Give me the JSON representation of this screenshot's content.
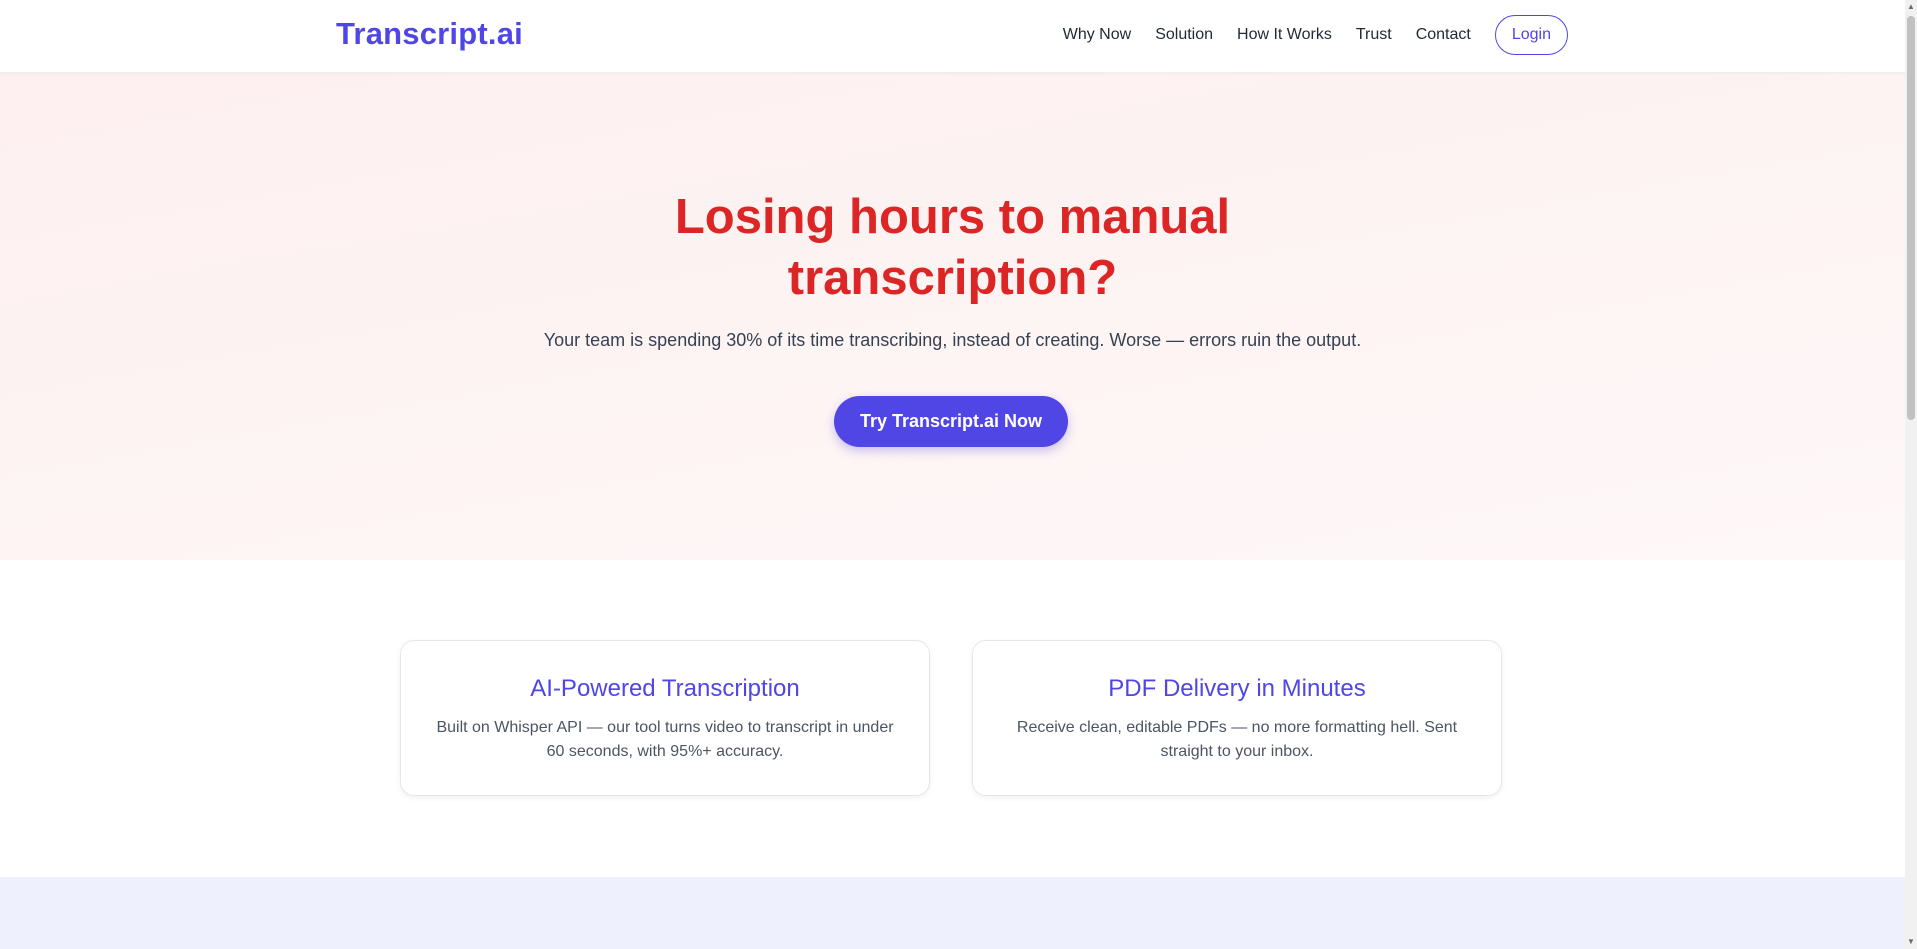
{
  "header": {
    "logo": "Transcript.ai",
    "nav": [
      "Why Now",
      "Solution",
      "How It Works",
      "Trust",
      "Contact"
    ],
    "login_label": "Login"
  },
  "hero": {
    "title": "Losing hours to manual transcription?",
    "subtitle": "Your team is spending 30% of its time transcribing, instead of creating. Worse — errors ruin the output.",
    "cta_label": "Try Transcript.ai Now"
  },
  "features": [
    {
      "title": "AI-Powered Transcription",
      "description": "Built on Whisper API — our tool turns video to transcript in under 60 seconds, with 95%+ accuracy."
    },
    {
      "title": "PDF Delivery in Minutes",
      "description": "Receive clean, editable PDFs — no more formatting hell. Sent straight to your inbox."
    }
  ],
  "colors": {
    "brand": "#4f46e5",
    "hero_title": "#dc2626",
    "hero_bg": "#fef0f0",
    "next_section_bg": "#eef1fd"
  },
  "icons": {
    "scroll_up": "scroll-up-arrow-icon",
    "scroll_down": "scroll-down-arrow-icon"
  }
}
